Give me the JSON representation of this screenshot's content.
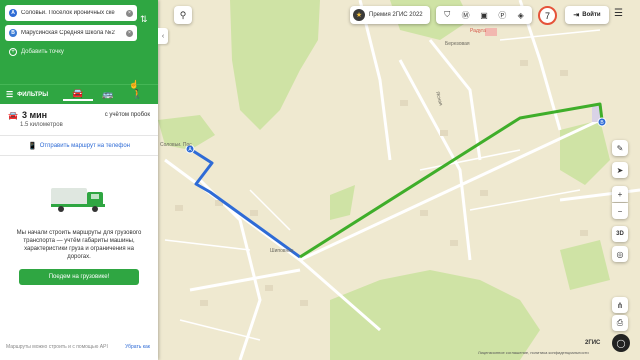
{
  "route": {
    "point_a_label": "A",
    "point_a": "Соловьи. Посёлок ироничных ске",
    "point_b_label": "B",
    "point_b": "Марусинская Средняя Школа №2",
    "add_point": "Добавить точку",
    "filters": "ФИЛЬТРЫ"
  },
  "result": {
    "time": "3 мин",
    "distance": "1.5 километров",
    "traffic": "с учётом пробок"
  },
  "send_to_phone": "Отправить маршрут на телефон",
  "truck": {
    "message": "Мы начали строить маршруты для грузового транспорта — учтём габариты машины, характеристики груза и ограничения на дорогах.",
    "button": "Поедем на грузовике!"
  },
  "footer": {
    "api_note": "Маршруты можно строить и с помощью API",
    "hide": "Убрать как"
  },
  "topbar": {
    "premium": "Премия 2ГИС 2022",
    "badge": "7",
    "login": "Войти"
  },
  "map": {
    "zoom_in": "+",
    "zoom_out": "−",
    "three_d": "3D",
    "logo": "2ГИС",
    "license": "Лицензионное соглашение, политика конфиденциальности",
    "street_1": "Березовая",
    "street_2": "Ясная",
    "street_3": "Шиповник",
    "place_1": "Радуга",
    "place_2": "Соловьи. Пос"
  },
  "colors": {
    "brand_green": "#2fa642",
    "route_blue": "#2e6bd6",
    "route_green": "#3fae2a"
  }
}
